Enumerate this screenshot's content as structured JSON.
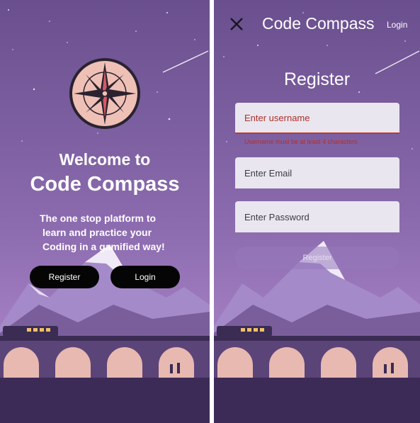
{
  "welcome": {
    "logo_icon": "compass-rose-icon",
    "line1": "Welcome to",
    "line2": "Code Compass",
    "tagline_1": "The one stop platform to",
    "tagline_2": "learn and practice your",
    "tagline_3": "Coding in a gamified way!",
    "register_label": "Register",
    "login_label": "Login"
  },
  "register": {
    "close_icon": "close-icon",
    "app_title": "Code Compass",
    "login_link": "Login",
    "heading": "Register",
    "username_placeholder": "Enter username",
    "username_error": "Username must be at least 4 characters",
    "email_placeholder": "Enter Email",
    "password_placeholder": "Enter Password",
    "submit_label": "Register"
  },
  "colors": {
    "sky_top": "#6a4f8e",
    "sky_bottom": "#a07cbf",
    "button_dark": "#050505",
    "field_bg": "#e9e6ef",
    "error_red": "#b0302a"
  }
}
